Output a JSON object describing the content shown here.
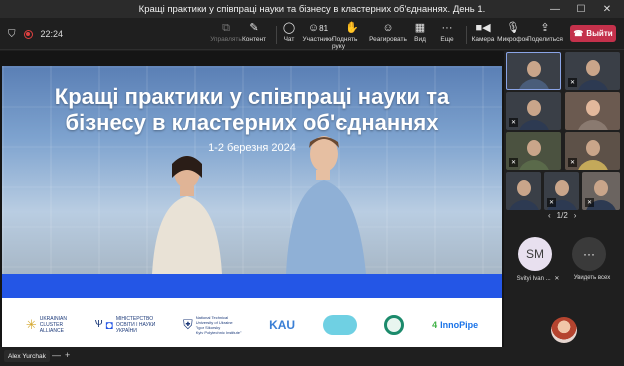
{
  "window": {
    "title": "Кращі практики у співпраці науки та бізнесу в кластерних об'єднаннях. День 1.",
    "controls": [
      "—",
      "☐",
      "✕"
    ]
  },
  "toolbar": {
    "timer": "22:24",
    "buttons": [
      {
        "label": "Управлять",
        "icon": "share-control-icon"
      },
      {
        "label": "Контент",
        "icon": "share-content-icon"
      },
      {
        "label": "Чат",
        "icon": "chat-icon"
      },
      {
        "label": "Участники",
        "icon": "participants-icon",
        "count": "81"
      },
      {
        "label": "Поднять руку",
        "icon": "raise-hand-icon"
      },
      {
        "label": "Реагировать",
        "icon": "react-icon"
      },
      {
        "label": "Вид",
        "icon": "view-icon"
      },
      {
        "label": "Еще",
        "icon": "more-icon"
      },
      {
        "label": "Камера",
        "icon": "camera-icon"
      },
      {
        "label": "Микрофон",
        "icon": "microphone-icon"
      },
      {
        "label": "Поделиться",
        "icon": "share-icon"
      }
    ],
    "leave_label": "Выйти",
    "leave_color": "#c4314b"
  },
  "slide": {
    "title_line1": "Кращі практики у співпраці науки та",
    "title_line2": "бізнесу в кластерних об'єднаннях",
    "date": "1-2 березня 2024",
    "band_color": "#2456e6",
    "logos": {
      "ucа_line1": "UKRAINIAN",
      "uca_line2": "CLUSTER",
      "uca_line3": "ALLIANCE",
      "mon_line1": "МІНІСТЕРСТВО",
      "mon_line2": "ОСВІТИ І НАУКИ",
      "mon_line3": "УКРАЇНИ",
      "kpi_line1": "National Technical",
      "kpi_line2": "University of Ukraine",
      "kpi_line3": "\"Igor Sikorsky",
      "kpi_line4": "Kyiv Polytechnic Institute\"",
      "kau": "KAU",
      "inno_prefix": "4",
      "inno_name": "InnoPipe"
    }
  },
  "presenter": {
    "name": "Alex Yurchak",
    "zoom_out": "—",
    "zoom_in": "+"
  },
  "panel": {
    "page": "1/2",
    "participant_initials": "SM",
    "participant_name": "Svityi Ivan ...",
    "see_all_label": "Увидеть всех"
  }
}
